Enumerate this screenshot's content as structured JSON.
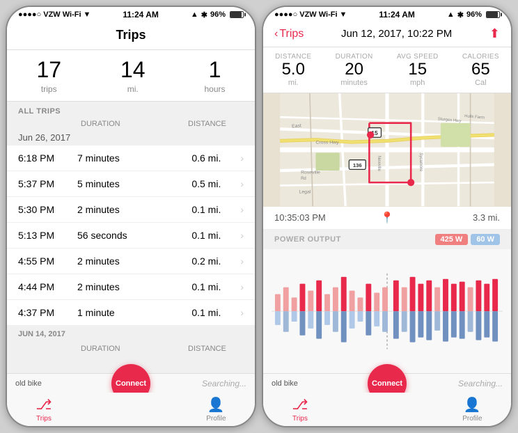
{
  "phone1": {
    "status": {
      "carrier": "VZW Wi-Fi",
      "time": "11:24 AM",
      "battery": "96%"
    },
    "header": {
      "title": "Trips"
    },
    "allTrips": {
      "label": "ALL TRIPS",
      "trips": {
        "value": "17",
        "label": "trips"
      },
      "miles": {
        "value": "14",
        "label": "mi."
      },
      "hours": {
        "value": "1",
        "label": "hours"
      }
    },
    "section": {
      "date": "Jun 26, 2017",
      "col_duration": "DURATION",
      "col_distance": "DISTANCE"
    },
    "trips": [
      {
        "time": "6:18 PM",
        "duration": "7 minutes",
        "distance": "0.6 mi."
      },
      {
        "time": "5:37 PM",
        "duration": "5 minutes",
        "distance": "0.5 mi."
      },
      {
        "time": "5:30 PM",
        "duration": "2 minutes",
        "distance": "0.1 mi."
      },
      {
        "time": "5:13 PM",
        "duration": "56 seconds",
        "distance": "0.1 mi."
      },
      {
        "time": "4:55 PM",
        "duration": "2 minutes",
        "distance": "0.2 mi."
      },
      {
        "time": "4:44 PM",
        "duration": "2 minutes",
        "distance": "0.1 mi."
      },
      {
        "time": "4:37 PM",
        "duration": "1 minute",
        "distance": "0.1 mi."
      }
    ],
    "bottom": {
      "device": "old bike",
      "searching": "Searching...",
      "connect": "Connect"
    },
    "tabs": [
      {
        "label": "Trips",
        "active": true
      },
      {
        "label": "Profile",
        "active": false
      }
    ]
  },
  "phone2": {
    "status": {
      "carrier": "VZW Wi-Fi",
      "time": "11:24 AM",
      "battery": "96%"
    },
    "header": {
      "back": "Trips",
      "date": "Jun 12, 2017, 10:22 PM"
    },
    "tripStats": [
      {
        "label": "DISTANCE",
        "value": "5.0",
        "unit": "mi."
      },
      {
        "label": "DURATION",
        "value": "20",
        "unit": "minutes"
      },
      {
        "label": "AVG SPEED",
        "value": "15",
        "unit": "mph"
      },
      {
        "label": "CALORIES",
        "value": "65",
        "unit": "Cal"
      }
    ],
    "mapInfo": {
      "time": "10:35:03 PM",
      "distance": "3.3 mi."
    },
    "power": {
      "label": "POWER OUTPUT",
      "high": "425 W",
      "low": "60 W"
    },
    "bottom": {
      "device": "old bike",
      "searching": "Searching...",
      "connect": "Connect"
    },
    "tabs": [
      {
        "label": "Trips",
        "active": true
      },
      {
        "label": "Profile",
        "active": false
      }
    ]
  }
}
